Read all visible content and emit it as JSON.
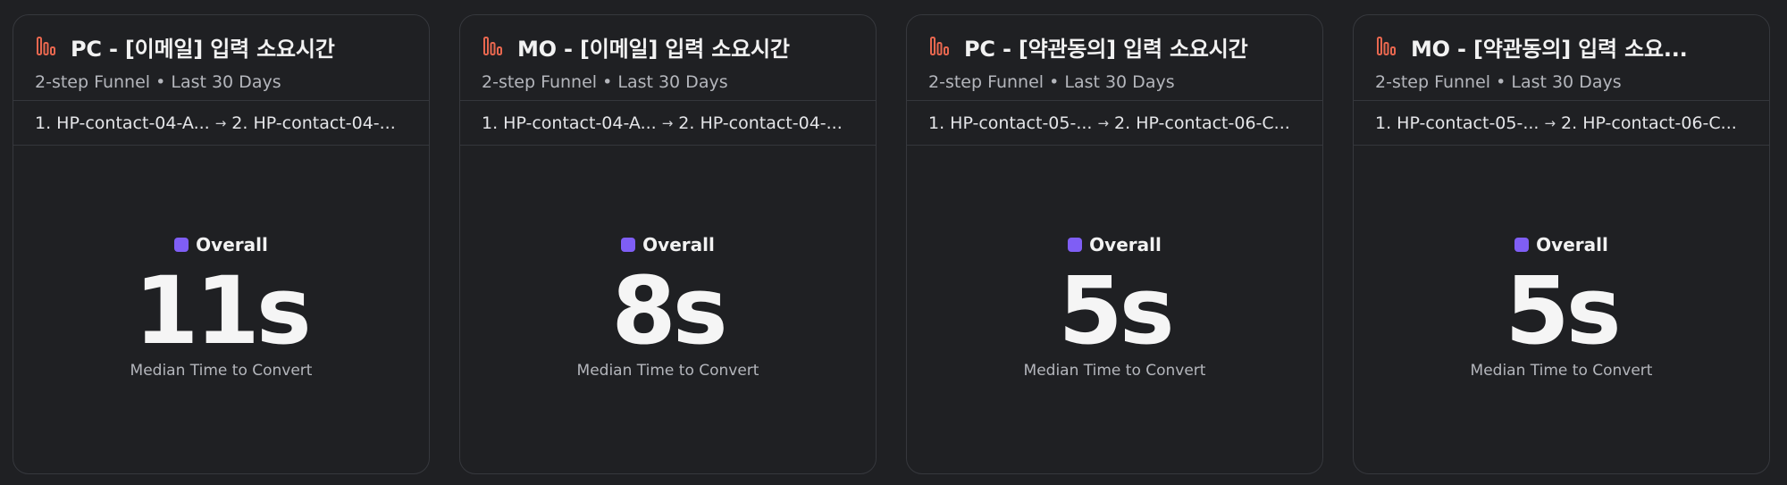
{
  "colors": {
    "background": "#1f2023",
    "card_border": "#36383d",
    "icon_accent": "#e8674f",
    "legend_swatch": "#7f5ef5"
  },
  "cards": [
    {
      "icon": "bar-chart-icon",
      "title": "PC - [이메일] 입력 소요시간",
      "subtitle": "2-step Funnel • Last 30 Days",
      "step1": "1. HP-contact-04-A...",
      "arrow": "→",
      "step2": "2. HP-contact-04-...",
      "legend": "Overall",
      "value": "11s",
      "caption": "Median Time to Convert"
    },
    {
      "icon": "bar-chart-icon",
      "title": "MO - [이메일] 입력 소요시간",
      "subtitle": "2-step Funnel • Last 30 Days",
      "step1": "1. HP-contact-04-A...",
      "arrow": "→",
      "step2": "2. HP-contact-04-...",
      "legend": "Overall",
      "value": "8s",
      "caption": "Median Time to Convert"
    },
    {
      "icon": "bar-chart-icon",
      "title": "PC - [약관동의] 입력 소요시간",
      "subtitle": "2-step Funnel • Last 30 Days",
      "step1": "1. HP-contact-05-...",
      "arrow": "→",
      "step2": "2. HP-contact-06-C...",
      "legend": "Overall",
      "value": "5s",
      "caption": "Median Time to Convert"
    },
    {
      "icon": "bar-chart-icon",
      "title": "MO - [약관동의] 입력 소요...",
      "subtitle": "2-step Funnel • Last 30 Days",
      "step1": "1. HP-contact-05-...",
      "arrow": "→",
      "step2": "2. HP-contact-06-C...",
      "legend": "Overall",
      "value": "5s",
      "caption": "Median Time to Convert"
    }
  ]
}
